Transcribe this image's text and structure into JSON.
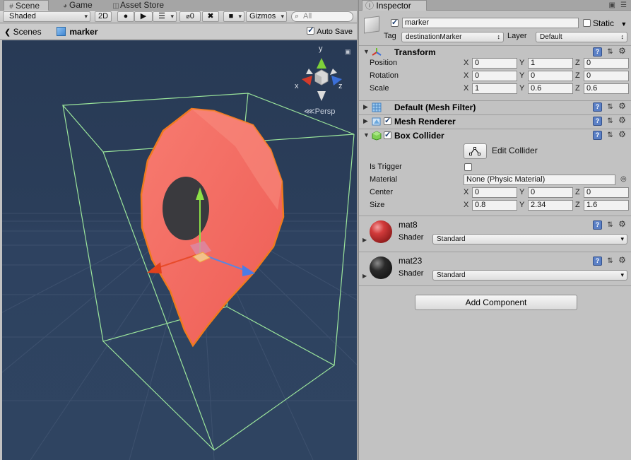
{
  "scene": {
    "tabs": [
      {
        "label": "Scene",
        "icon": "hash-icon"
      },
      {
        "label": "Game",
        "icon": "pacman-icon"
      },
      {
        "label": "Asset Store",
        "icon": "bag-icon"
      }
    ],
    "toolbar": {
      "shading_mode": "Shaded",
      "mode_2d": "2D",
      "effects_count": "0",
      "gizmos_label": "Gizmos",
      "search_placeholder": "All"
    },
    "breadcrumb": {
      "root": "Scenes",
      "current": "marker"
    },
    "auto_save_label": "Auto Save",
    "auto_save_checked": true,
    "viewport": {
      "projection_label": "Persp",
      "gizmo_axes": {
        "x": "x",
        "y": "y",
        "z": "z"
      }
    }
  },
  "inspector": {
    "tab_label": "Inspector",
    "object": {
      "name": "marker",
      "active": true,
      "static_label": "Static",
      "tag_label": "Tag",
      "tag_value": "destinationMarker",
      "layer_label": "Layer",
      "layer_value": "Default"
    },
    "transform": {
      "title": "Transform",
      "rows": [
        {
          "label": "Position",
          "x": "0",
          "y": "1",
          "z": "0"
        },
        {
          "label": "Rotation",
          "x": "0",
          "y": "0",
          "z": "0"
        },
        {
          "label": "Scale",
          "x": "1",
          "y": "0.6",
          "z": "0.6"
        }
      ]
    },
    "mesh_filter": {
      "title": "Default (Mesh Filter)"
    },
    "mesh_renderer": {
      "title": "Mesh Renderer"
    },
    "box_collider": {
      "title": "Box Collider",
      "edit_collider_label": "Edit Collider",
      "is_trigger_label": "Is Trigger",
      "material_label": "Material",
      "material_value": "None (Physic Material)",
      "center": {
        "label": "Center",
        "x": "0",
        "y": "0",
        "z": "0"
      },
      "size": {
        "label": "Size",
        "x": "0.8",
        "y": "2.34",
        "z": "1.6"
      }
    },
    "materials": [
      {
        "name": "mat8",
        "shader_label": "Shader",
        "shader": "Standard",
        "color": "#c0392b"
      },
      {
        "name": "mat23",
        "shader_label": "Shader",
        "shader": "Standard",
        "color": "#1f1f1f"
      }
    ],
    "add_component_label": "Add Component"
  },
  "colors": {
    "sky": "#283a55",
    "grid": "#4a5d7a",
    "marker_fill": "#f36a64",
    "marker_outline": "#f07a1e",
    "collider_green": "#9be59b"
  }
}
